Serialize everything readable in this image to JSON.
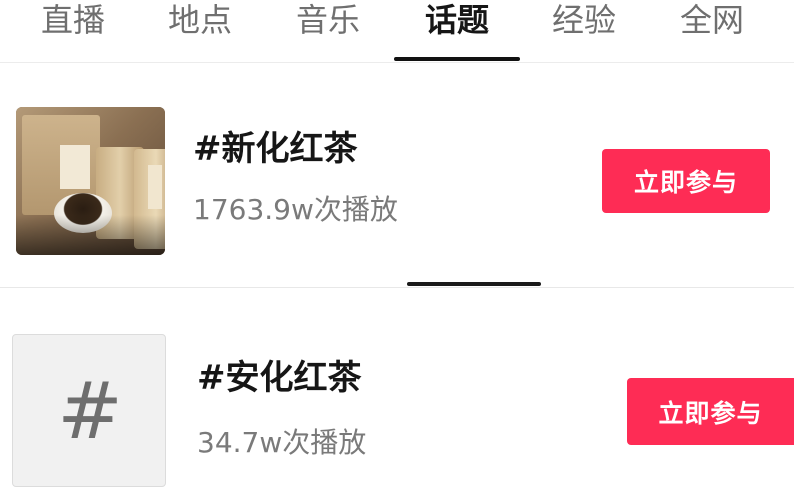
{
  "tabs": [
    {
      "label": "直播"
    },
    {
      "label": "地点"
    },
    {
      "label": "音乐"
    },
    {
      "label": "话题",
      "active": true
    },
    {
      "label": "经验"
    },
    {
      "label": "全网"
    }
  ],
  "topics": [
    {
      "title": "#新化红茶",
      "plays": "1763.9w次播放",
      "button": "立即参与",
      "thumbnail": "photo"
    },
    {
      "title": "#安化红茶",
      "plays": "34.7w次播放",
      "button": "立即参与",
      "thumbnail": "hash-icon"
    }
  ],
  "hash_glyph": "#",
  "colors": {
    "accent": "#fe2c55",
    "active_tab": "#161616",
    "inactive_tab": "#6f6f6f",
    "subtext": "#7a7a7a"
  }
}
